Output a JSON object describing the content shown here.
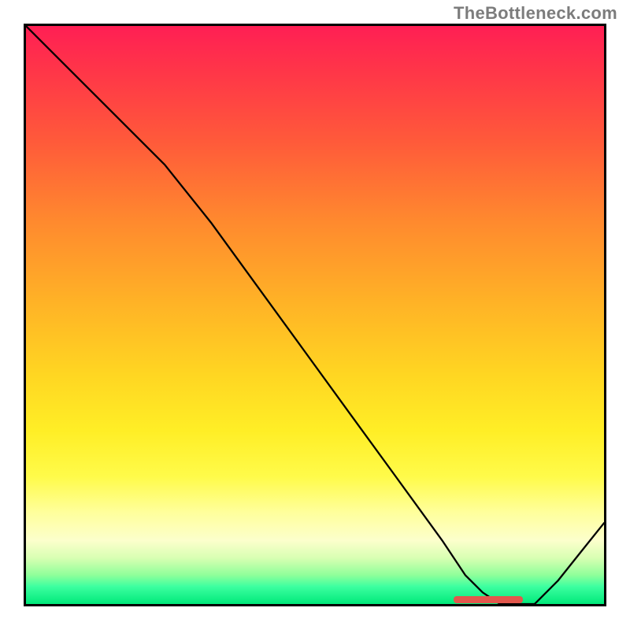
{
  "watermark": "TheBottleneck.com",
  "chart_data": {
    "type": "line",
    "title": "",
    "xlabel": "",
    "ylabel": "",
    "xlim": [
      0,
      100
    ],
    "ylim": [
      0,
      100
    ],
    "series": [
      {
        "name": "curve",
        "x": [
          0,
          4,
          10,
          17,
          24,
          32,
          40,
          48,
          56,
          64,
          72,
          76,
          79,
          82,
          85,
          88,
          92,
          96,
          100
        ],
        "values": [
          100,
          96,
          90,
          83,
          76,
          66,
          55,
          44,
          33,
          22,
          11,
          5,
          2,
          0,
          0,
          0,
          4,
          9,
          14
        ]
      }
    ],
    "highlight_segment": {
      "x_start": 74,
      "x_end": 86,
      "y": 0
    },
    "background": "heatmap-gradient-red-to-green"
  }
}
